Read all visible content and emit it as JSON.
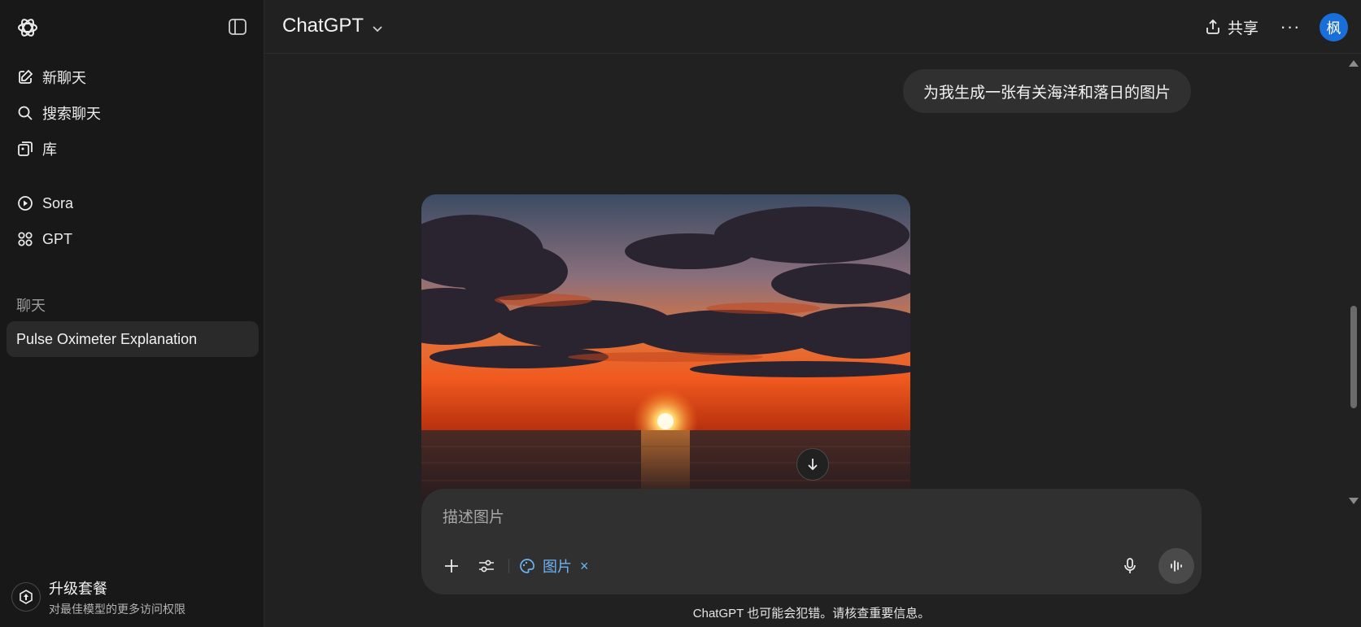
{
  "sidebar": {
    "logo_icon": "openai-logo-icon",
    "toggle_icon": "sidebar-toggle-icon",
    "nav": [
      {
        "label": "新聊天",
        "icon": "edit-icon"
      },
      {
        "label": "搜索聊天",
        "icon": "search-icon"
      },
      {
        "label": "库",
        "icon": "library-icon"
      },
      {
        "label": "Sora",
        "icon": "play-circle-icon"
      },
      {
        "label": "GPT",
        "icon": "grid-icon"
      }
    ],
    "section_label": "聊天",
    "chats": [
      {
        "label": "Pulse Oximeter Explanation"
      }
    ],
    "upgrade": {
      "title": "升级套餐",
      "subtitle": "对最佳模型的更多访问权限",
      "icon": "upgrade-badge-icon"
    }
  },
  "header": {
    "model_name": "ChatGPT",
    "share_label": "共享",
    "more_label": "···",
    "avatar_initial": "枫",
    "avatar_color": "#1a6ed8"
  },
  "conversation": {
    "user_message": "为我生成一张有关海洋和落日的图片",
    "generated_image": "ocean-sunset-image"
  },
  "composer": {
    "placeholder": "描述图片",
    "active_tool": "图片",
    "active_tool_close": "×",
    "tool_color": "#6fb3f2"
  },
  "footer": {
    "disclaimer": "ChatGPT 也可能会犯错。请核查重要信息。"
  }
}
